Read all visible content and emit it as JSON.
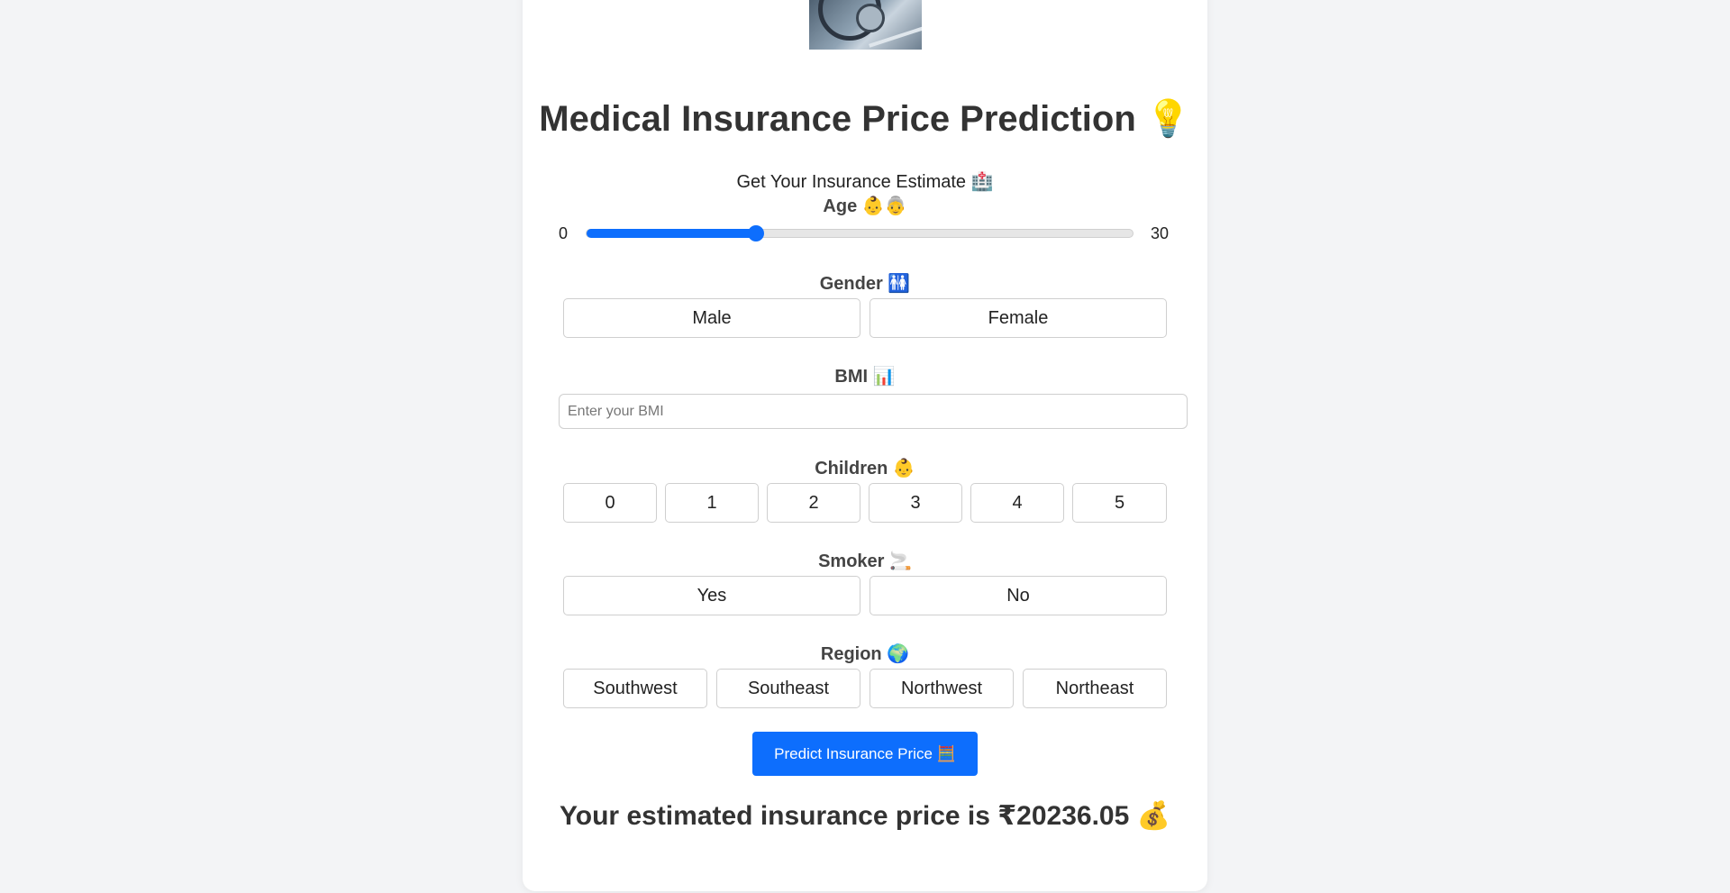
{
  "header": {
    "title": "Medical Insurance Price Prediction",
    "title_emoji": "💡",
    "subtitle": "Get Your Insurance Estimate",
    "subtitle_emoji": "🏥"
  },
  "age": {
    "label": "Age",
    "emoji": "👶👵",
    "min": "0",
    "max": "30",
    "fill_fraction": 0.31
  },
  "gender": {
    "label": "Gender",
    "emoji": "🚻",
    "options": [
      "Male",
      "Female"
    ]
  },
  "bmi": {
    "label": "BMI",
    "emoji": "📊",
    "placeholder": "Enter your BMI",
    "value": ""
  },
  "children": {
    "label": "Children",
    "emoji": "👶",
    "options": [
      "0",
      "1",
      "2",
      "3",
      "4",
      "5"
    ]
  },
  "smoker": {
    "label": "Smoker",
    "emoji": "🚬",
    "options": [
      "Yes",
      "No"
    ]
  },
  "region": {
    "label": "Region",
    "emoji": "🌍",
    "options": [
      "Southwest",
      "Southeast",
      "Northwest",
      "Northeast"
    ]
  },
  "predict_button": {
    "label": "Predict Insurance Price",
    "emoji": "🧮"
  },
  "result": {
    "text": "Your estimated insurance price is ₹20236.05",
    "emoji": "💰"
  },
  "colors": {
    "accent": "#0d6efd",
    "background": "#f3f4f6",
    "card": "#ffffff"
  }
}
